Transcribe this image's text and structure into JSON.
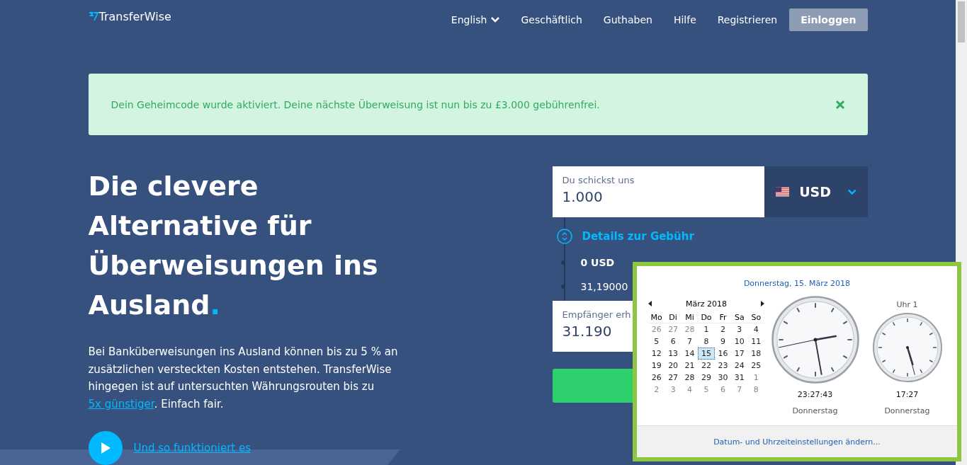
{
  "header": {
    "logo": "TransferWise",
    "nav": [
      {
        "label": "English",
        "kind": "dropdown"
      },
      {
        "label": "Geschäftlich",
        "kind": "link"
      },
      {
        "label": "Guthaben",
        "kind": "link"
      },
      {
        "label": "Hilfe",
        "kind": "link"
      },
      {
        "label": "Registrieren",
        "kind": "link"
      },
      {
        "label": "Einloggen",
        "kind": "button"
      }
    ]
  },
  "alert": {
    "message": "Dein Geheimcode wurde aktiviert. Deine nächste Überweisung ist nun bis zu £3.000 gebührenfrei."
  },
  "hero": {
    "heading": "Die clevere Alternative für Überweisungen ins Ausland",
    "heading_dot": ".",
    "text": "Bei Banküberweisungen ins Ausland können bis zu 5 % an zusätzlichen versteckten Kosten entstehen. TransferWise hingegen ist auf untersuchten Währungsrouten bis zu ",
    "link": "5x günstiger",
    "text_after": ". Einfach fair.",
    "video_link": "Und so funktioniert es"
  },
  "calculator": {
    "send_label": "Du schickst uns",
    "send_value": "1.000",
    "currency": "USD",
    "fee_toggle": "Details zur Gebühr",
    "fee": "0 USD",
    "rate": "31,19000",
    "receive_label": "Empfänger erh",
    "receive_value": "31.190"
  },
  "clock_popup": {
    "date_title": "Donnerstag, 15. März 2018",
    "month": "März 2018",
    "weekdays": [
      "Mo",
      "Di",
      "Mi",
      "Do",
      "Fr",
      "Sa",
      "So"
    ],
    "days": [
      {
        "d": "26",
        "other_month": true,
        "selected": false
      },
      {
        "d": "27",
        "other_month": true,
        "selected": false
      },
      {
        "d": "28",
        "other_month": true,
        "selected": false
      },
      {
        "d": "1",
        "other_month": false,
        "selected": false
      },
      {
        "d": "2",
        "other_month": false,
        "selected": false
      },
      {
        "d": "3",
        "other_month": false,
        "selected": false
      },
      {
        "d": "4",
        "other_month": false,
        "selected": false
      },
      {
        "d": "5",
        "other_month": false,
        "selected": false
      },
      {
        "d": "6",
        "other_month": false,
        "selected": false
      },
      {
        "d": "7",
        "other_month": false,
        "selected": false
      },
      {
        "d": "8",
        "other_month": false,
        "selected": false
      },
      {
        "d": "9",
        "other_month": false,
        "selected": false
      },
      {
        "d": "10",
        "other_month": false,
        "selected": false
      },
      {
        "d": "11",
        "other_month": false,
        "selected": false
      },
      {
        "d": "12",
        "other_month": false,
        "selected": false
      },
      {
        "d": "13",
        "other_month": false,
        "selected": false
      },
      {
        "d": "14",
        "other_month": false,
        "selected": false
      },
      {
        "d": "15",
        "other_month": false,
        "selected": true
      },
      {
        "d": "16",
        "other_month": false,
        "selected": false
      },
      {
        "d": "17",
        "other_month": false,
        "selected": false
      },
      {
        "d": "18",
        "other_month": false,
        "selected": false
      },
      {
        "d": "19",
        "other_month": false,
        "selected": false
      },
      {
        "d": "20",
        "other_month": false,
        "selected": false
      },
      {
        "d": "21",
        "other_month": false,
        "selected": false
      },
      {
        "d": "22",
        "other_month": false,
        "selected": false
      },
      {
        "d": "23",
        "other_month": false,
        "selected": false
      },
      {
        "d": "24",
        "other_month": false,
        "selected": false
      },
      {
        "d": "25",
        "other_month": false,
        "selected": false
      },
      {
        "d": "26",
        "other_month": false,
        "selected": false
      },
      {
        "d": "27",
        "other_month": false,
        "selected": false
      },
      {
        "d": "28",
        "other_month": false,
        "selected": false
      },
      {
        "d": "29",
        "other_month": false,
        "selected": false
      },
      {
        "d": "30",
        "other_month": false,
        "selected": false
      },
      {
        "d": "31",
        "other_month": false,
        "selected": false
      },
      {
        "d": "1",
        "other_month": true,
        "selected": false
      },
      {
        "d": "2",
        "other_month": true,
        "selected": false
      },
      {
        "d": "3",
        "other_month": true,
        "selected": false
      },
      {
        "d": "4",
        "other_month": true,
        "selected": false
      },
      {
        "d": "5",
        "other_month": true,
        "selected": false
      },
      {
        "d": "6",
        "other_month": true,
        "selected": false
      },
      {
        "d": "7",
        "other_month": true,
        "selected": false
      },
      {
        "d": "8",
        "other_month": true,
        "selected": false
      }
    ],
    "clocks": [
      {
        "time": "23:27:43",
        "day": "Donnerstag",
        "kind": "main"
      },
      {
        "label": "Uhr 1",
        "time": "17:27",
        "day": "Donnerstag",
        "kind": "extra"
      }
    ],
    "settings_link": "Datum- und Uhrzeiteinstellungen ändern..."
  }
}
